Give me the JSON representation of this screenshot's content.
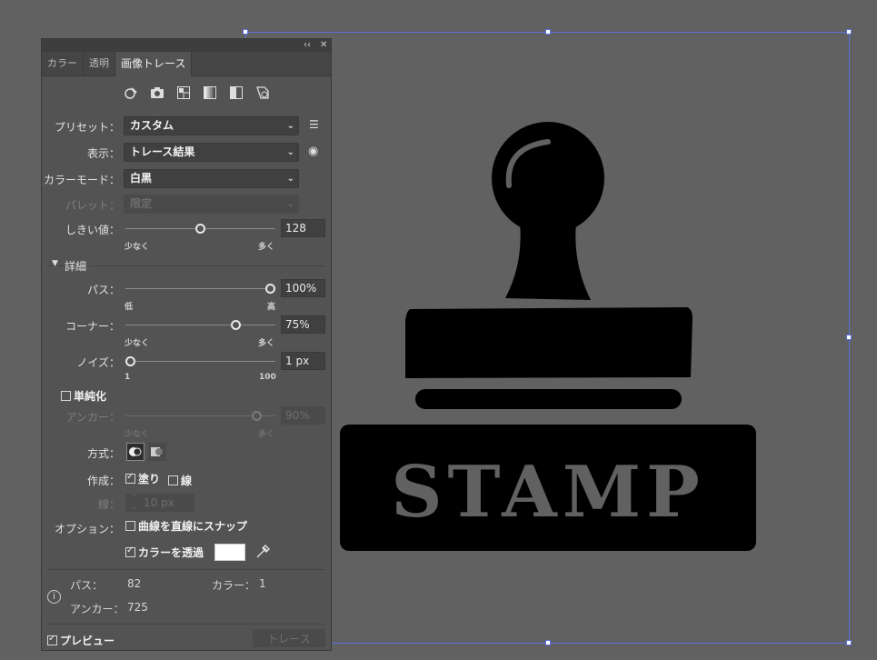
{
  "panel": {
    "collapse_icon": "double-chevron-left-icon",
    "close_icon": "close-icon",
    "tabs": [
      {
        "label": "カラー",
        "active": false
      },
      {
        "label": "透明",
        "active": false
      },
      {
        "label": "画像トレース",
        "active": true
      }
    ],
    "preset_icons": [
      "auto-color-icon",
      "high-color-icon",
      "low-color-icon",
      "grayscale-icon",
      "black-and-white-icon",
      "outline-icon"
    ],
    "preset": {
      "label": "プリセット：",
      "value": "カスタム",
      "menu_icon": "list-menu-icon"
    },
    "view": {
      "label": "表示：",
      "value": "トレース結果",
      "eye_icon": "eye-icon"
    },
    "mode": {
      "label": "カラーモード：",
      "value": "白黒"
    },
    "palette": {
      "label": "パレット：",
      "value": "限定"
    },
    "threshold": {
      "label": "しきい値：",
      "value": "128",
      "fraction": 0.5,
      "min_label": "少なく",
      "max_label": "多く"
    },
    "advanced": {
      "label": "詳細"
    },
    "paths": {
      "label": "パス：",
      "value": "100%",
      "fraction": 1.0,
      "min_label": "低",
      "max_label": "高"
    },
    "corners": {
      "label": "コーナー：",
      "value": "75%",
      "fraction": 0.75,
      "min_label": "少なく",
      "max_label": "多く"
    },
    "noise": {
      "label": "ノイズ：",
      "value": "1 px",
      "fraction": 0.0,
      "min_label": "1",
      "max_label": "100"
    },
    "simplify": {
      "label": "単純化",
      "checked": false
    },
    "anchors": {
      "label": "アンカー：",
      "value": "90%",
      "fraction": 0.9,
      "min_label": "少なく",
      "max_label": "多く"
    },
    "method": {
      "label": "方式："
    },
    "create": {
      "label": "作成：",
      "fills": "塗り",
      "fills_checked": true,
      "strokes": "線",
      "strokes_checked": false
    },
    "stroke": {
      "label": "線：",
      "value": "10 px"
    },
    "options": {
      "label": "オプション：",
      "snap": "曲線を直線にスナップ",
      "snap_checked": false,
      "ignore_white": "カラーを透過",
      "ignore_white_checked": true,
      "swatch_color": "#ffffff"
    },
    "info": {
      "paths_label": "パス：",
      "paths_value": "82",
      "colors_label": "カラー：",
      "colors_value": "1",
      "anchors_label": "アンカー：",
      "anchors_value": "725"
    },
    "preview": {
      "label": "プレビュー",
      "checked": true
    },
    "trace_button": "トレース"
  },
  "artwork": {
    "text": "STAMP"
  }
}
